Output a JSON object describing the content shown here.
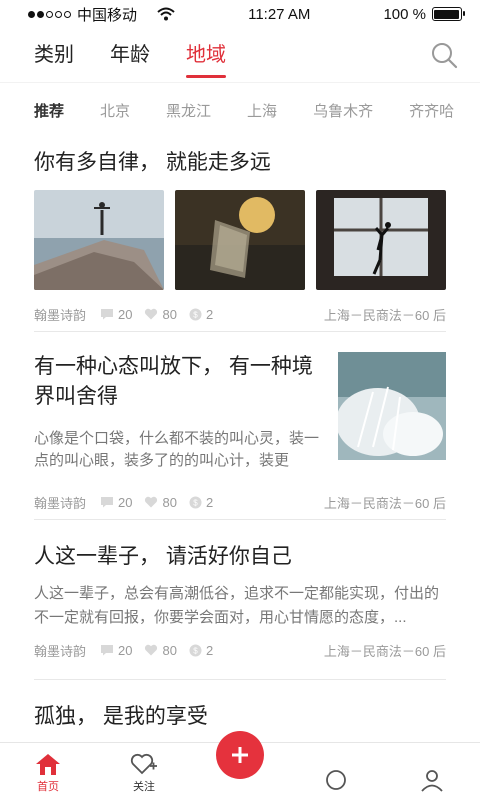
{
  "status_bar": {
    "carrier": "中国移动",
    "time": "11:27 AM",
    "battery_percent": "100 %",
    "battery_level": 1.0,
    "signal_bars_filled": 2
  },
  "top_tabs": [
    {
      "label": "类别"
    },
    {
      "label": "年龄"
    },
    {
      "label": "地域"
    }
  ],
  "top_tabs_active": "地域",
  "region_tabs": [
    {
      "label": "推荐"
    },
    {
      "label": "北京"
    },
    {
      "label": "黑龙江"
    },
    {
      "label": "上海"
    },
    {
      "label": "乌鲁木齐"
    },
    {
      "label": "齐齐哈"
    }
  ],
  "posts": [
    {
      "title": "你有多自律， 就能走多远",
      "author": "翰墨诗韵",
      "comments": "20",
      "likes": "80",
      "coins": "2",
      "location": "上海－民商法－60 后"
    },
    {
      "title": "有一种心态叫放下， 有一种境界叫舍得",
      "excerpt": "心像是个口袋，什么都不装的叫心灵，装一点的叫心眼，装多了的的叫心计，装更",
      "author": "翰墨诗韵",
      "comments": "20",
      "likes": "80",
      "coins": "2",
      "location": "上海－民商法－60 后"
    },
    {
      "title": "人这一辈子， 请活好你自己",
      "excerpt": "人这一辈子，总会有高潮低谷，追求不一定都能实现，付出的不一定就有回报，你要学会面对，用心甘情愿的态度，...",
      "author": "翰墨诗韵",
      "comments": "20",
      "likes": "80",
      "coins": "2",
      "location": "上海－民商法－60 后"
    },
    {
      "title": "孤独， 是我的享受"
    }
  ],
  "bottom_nav": {
    "home": "首页",
    "follow": "关注"
  },
  "colors": {
    "accent": "#e0303a",
    "muted_text": "#9a9a9a"
  },
  "icons": [
    "search-icon",
    "comment-icon",
    "heart-icon",
    "coin-icon",
    "home-icon",
    "follow-icon",
    "plus-icon"
  ]
}
